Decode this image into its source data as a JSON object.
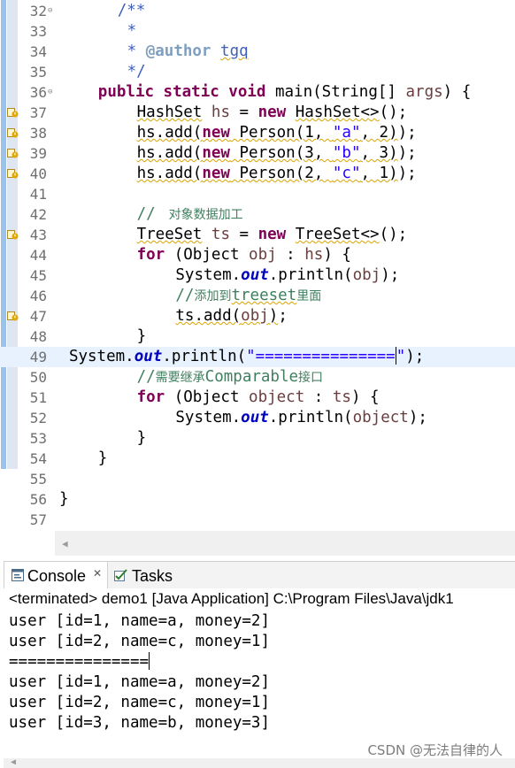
{
  "editor": {
    "lines": [
      {
        "n": "32",
        "fold": true,
        "marker": "none",
        "indent": 6,
        "tokens": [
          {
            "t": "/**",
            "c": "jd"
          }
        ]
      },
      {
        "n": "33",
        "fold": false,
        "marker": "none",
        "indent": 7,
        "tokens": [
          {
            "t": "*",
            "c": "jd"
          }
        ]
      },
      {
        "n": "34",
        "fold": false,
        "marker": "none",
        "indent": 7,
        "tokens": [
          {
            "t": "* ",
            "c": "jd"
          },
          {
            "t": "@author",
            "c": "tag"
          },
          {
            "t": " ",
            "c": "jd"
          },
          {
            "t": "tgq",
            "c": "jd sq"
          }
        ]
      },
      {
        "n": "35",
        "fold": false,
        "marker": "none",
        "indent": 7,
        "tokens": [
          {
            "t": "*/",
            "c": "jd"
          }
        ]
      },
      {
        "n": "36",
        "fold": true,
        "marker": "none",
        "indent": 4,
        "tokens": [
          {
            "t": "public static void",
            "c": "kw"
          },
          {
            "t": " main(String[] "
          },
          {
            "t": "args",
            "c": "var"
          },
          {
            "t": ") {"
          }
        ]
      },
      {
        "n": "37",
        "fold": false,
        "marker": "warning",
        "indent": 8,
        "tokens": [
          {
            "t": "HashSet",
            "c": "sq"
          },
          {
            "t": " "
          },
          {
            "t": "hs",
            "c": "var"
          },
          {
            "t": " = "
          },
          {
            "t": "new",
            "c": "kw"
          },
          {
            "t": " "
          },
          {
            "t": "HashSet<>",
            "c": "sq"
          },
          {
            "t": "();"
          }
        ]
      },
      {
        "n": "38",
        "fold": false,
        "marker": "warning",
        "indent": 8,
        "tokens": [
          {
            "t": "hs.add(",
            "c": "sq"
          },
          {
            "t": "new",
            "c": "kw sq"
          },
          {
            "t": " Person(1, ",
            "c": "sq"
          },
          {
            "t": "\"a\"",
            "c": "str sq"
          },
          {
            "t": ", 2)",
            "c": "sq"
          },
          {
            "t": ");"
          }
        ]
      },
      {
        "n": "39",
        "fold": false,
        "marker": "warning",
        "indent": 8,
        "tokens": [
          {
            "t": "hs.add(",
            "c": "sq"
          },
          {
            "t": "new",
            "c": "kw sq"
          },
          {
            "t": " Person(3, ",
            "c": "sq"
          },
          {
            "t": "\"b\"",
            "c": "str sq"
          },
          {
            "t": ", 3)",
            "c": "sq"
          },
          {
            "t": ");"
          }
        ]
      },
      {
        "n": "40",
        "fold": false,
        "marker": "warning",
        "indent": 8,
        "tokens": [
          {
            "t": "hs.add(",
            "c": "sq"
          },
          {
            "t": "new",
            "c": "kw sq"
          },
          {
            "t": " Person(2, ",
            "c": "sq"
          },
          {
            "t": "\"c\"",
            "c": "str sq"
          },
          {
            "t": ", 1)",
            "c": "sq"
          },
          {
            "t": ");"
          }
        ]
      },
      {
        "n": "41",
        "fold": false,
        "marker": "none",
        "indent": 0,
        "tokens": []
      },
      {
        "n": "42",
        "fold": false,
        "marker": "none",
        "indent": 8,
        "tokens": [
          {
            "t": "// ",
            "c": "cm"
          },
          {
            "t": " 对象数据加工",
            "c": "cm cn"
          }
        ]
      },
      {
        "n": "43",
        "fold": false,
        "marker": "warning",
        "indent": 8,
        "tokens": [
          {
            "t": "TreeSet",
            "c": "sq"
          },
          {
            "t": " "
          },
          {
            "t": "ts",
            "c": "var"
          },
          {
            "t": " = "
          },
          {
            "t": "new",
            "c": "kw"
          },
          {
            "t": " "
          },
          {
            "t": "TreeSet<>",
            "c": "sq"
          },
          {
            "t": "();"
          }
        ]
      },
      {
        "n": "44",
        "fold": false,
        "marker": "none",
        "indent": 8,
        "tokens": [
          {
            "t": "for",
            "c": "kw"
          },
          {
            "t": " (Object "
          },
          {
            "t": "obj",
            "c": "var"
          },
          {
            "t": " : "
          },
          {
            "t": "hs",
            "c": "var"
          },
          {
            "t": ") {"
          }
        ]
      },
      {
        "n": "45",
        "fold": false,
        "marker": "none",
        "indent": 12,
        "tokens": [
          {
            "t": "System."
          },
          {
            "t": "out",
            "c": "fld"
          },
          {
            "t": ".println("
          },
          {
            "t": "obj",
            "c": "var"
          },
          {
            "t": ");"
          }
        ]
      },
      {
        "n": "46",
        "fold": false,
        "marker": "none",
        "indent": 12,
        "tokens": [
          {
            "t": "//",
            "c": "cm"
          },
          {
            "t": "添加到",
            "c": "cm cn"
          },
          {
            "t": "treeset",
            "c": "cm sq"
          },
          {
            "t": "里面",
            "c": "cm cn"
          }
        ]
      },
      {
        "n": "47",
        "fold": false,
        "marker": "warning",
        "indent": 12,
        "tokens": [
          {
            "t": "ts.add(",
            "c": "sq"
          },
          {
            "t": "obj",
            "c": "var sq"
          },
          {
            "t": ")",
            "c": "sq"
          },
          {
            "t": ";"
          }
        ]
      },
      {
        "n": "48",
        "fold": false,
        "marker": "none",
        "indent": 8,
        "tokens": [
          {
            "t": "}"
          }
        ]
      },
      {
        "n": "49",
        "fold": false,
        "marker": "none",
        "indent": 1,
        "current": true,
        "tokens": [
          {
            "t": "System."
          },
          {
            "t": "out",
            "c": "fld"
          },
          {
            "t": ".println("
          },
          {
            "t": "\"===============\"",
            "c": "str"
          },
          {
            "t": ");"
          }
        ]
      },
      {
        "n": "50",
        "fold": false,
        "marker": "none",
        "indent": 8,
        "tokens": [
          {
            "t": "//",
            "c": "cm"
          },
          {
            "t": "需要继承",
            "c": "cm cn"
          },
          {
            "t": "Comparable",
            "c": "cm"
          },
          {
            "t": "接口",
            "c": "cm cn"
          }
        ]
      },
      {
        "n": "51",
        "fold": false,
        "marker": "none",
        "indent": 8,
        "tokens": [
          {
            "t": "for",
            "c": "kw"
          },
          {
            "t": " (Object "
          },
          {
            "t": "object",
            "c": "var"
          },
          {
            "t": " : "
          },
          {
            "t": "ts",
            "c": "var"
          },
          {
            "t": ") {"
          }
        ]
      },
      {
        "n": "52",
        "fold": false,
        "marker": "none",
        "indent": 12,
        "tokens": [
          {
            "t": "System."
          },
          {
            "t": "out",
            "c": "fld"
          },
          {
            "t": ".println("
          },
          {
            "t": "object",
            "c": "var"
          },
          {
            "t": ");"
          }
        ]
      },
      {
        "n": "53",
        "fold": false,
        "marker": "none",
        "indent": 8,
        "tokens": [
          {
            "t": "}"
          }
        ]
      },
      {
        "n": "54",
        "fold": false,
        "marker": "none",
        "indent": 4,
        "tokens": [
          {
            "t": "}"
          }
        ]
      },
      {
        "n": "55",
        "fold": false,
        "marker": "none",
        "indent": 0,
        "tokens": []
      },
      {
        "n": "56",
        "fold": false,
        "marker": "none",
        "indent": 0,
        "tokens": [
          {
            "t": "}"
          }
        ]
      },
      {
        "n": "57",
        "fold": false,
        "marker": "none",
        "indent": 0,
        "tokens": []
      }
    ]
  },
  "console": {
    "tabs": [
      {
        "label": "Console",
        "close": "✕",
        "active": true,
        "icon": "console-icon"
      },
      {
        "label": "Tasks",
        "active": false,
        "icon": "tasks-icon"
      }
    ],
    "process_line": "<terminated> demo1 [Java Application] C:\\Program Files\\Java\\jdk1",
    "output": [
      "user [id=1, name=a, money=2]",
      "user [id=2, name=c, money=1]",
      "===============",
      "user [id=1, name=a, money=2]",
      "user [id=2, name=c, money=1]",
      "user [id=3, name=b, money=3]"
    ]
  },
  "watermark": "CSDN @无法自律的人",
  "colors": {
    "keyword": "#7f0055",
    "string": "#2a00ff",
    "comment": "#3f7f5f",
    "javadoc": "#3f5fbf",
    "field": "#0000c0",
    "current_line": "#e8f2fe",
    "warning_underline": "#d9a400"
  }
}
